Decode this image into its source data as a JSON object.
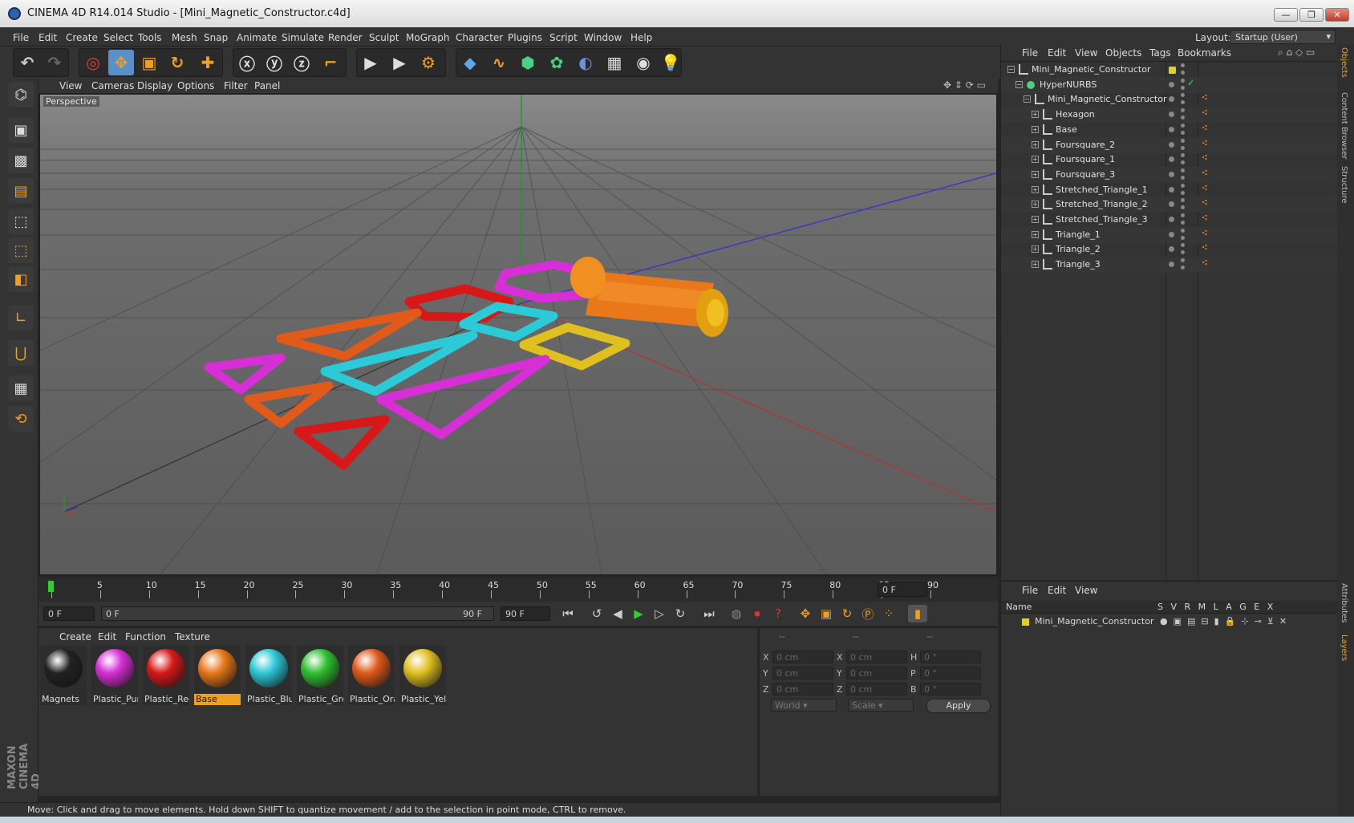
{
  "window": {
    "title": "CINEMA 4D R14.014 Studio - [Mini_Magnetic_Constructor.c4d]"
  },
  "menu": {
    "items": [
      "File",
      "Edit",
      "Create",
      "Select",
      "Tools",
      "Mesh",
      "Snap",
      "Animate",
      "Simulate",
      "Render",
      "Sculpt",
      "MoGraph",
      "Character",
      "Plugins",
      "Script",
      "Window",
      "Help"
    ],
    "layout_label": "Layout:",
    "layout_value": "Startup (User)"
  },
  "viewport": {
    "menu": [
      "View",
      "Cameras",
      "Display",
      "Options",
      "Filter",
      "Panel"
    ],
    "label": "Perspective"
  },
  "timeline": {
    "ticks": [
      "0",
      "5",
      "10",
      "15",
      "20",
      "25",
      "30",
      "35",
      "40",
      "45",
      "50",
      "55",
      "60",
      "65",
      "70",
      "75",
      "80",
      "85",
      "90"
    ],
    "current_frame": "0 F"
  },
  "transport": {
    "start": "0 F",
    "range_start": "0 F",
    "range_end": "90 F",
    "end": "90 F"
  },
  "materials": {
    "menu": [
      "Create",
      "Edit",
      "Function",
      "Texture"
    ],
    "items": [
      {
        "label": "Magnets",
        "color": "#222222"
      },
      {
        "label": "Plastic_Purp",
        "color": "#d62fd6"
      },
      {
        "label": "Plastic_Red",
        "color": "#d81818"
      },
      {
        "label": "Base",
        "color": "#e8781a"
      },
      {
        "label": "Plastic_Blue",
        "color": "#2cc9d6"
      },
      {
        "label": "Plastic_Gre",
        "color": "#30c030"
      },
      {
        "label": "Plastic_Ora",
        "color": "#e05a1a"
      },
      {
        "label": "Plastic_Yell",
        "color": "#e0c020"
      }
    ]
  },
  "coords": {
    "headers": [
      "--",
      "--",
      "--"
    ],
    "rows": [
      {
        "a": "X",
        "av": "0 cm",
        "b": "X",
        "bv": "0 cm",
        "c": "H",
        "cv": "0 °"
      },
      {
        "a": "Y",
        "av": "0 cm",
        "b": "Y",
        "bv": "0 cm",
        "c": "P",
        "cv": "0 °"
      },
      {
        "a": "Z",
        "av": "0 cm",
        "b": "Z",
        "bv": "0 cm",
        "c": "B",
        "cv": "0 °"
      }
    ],
    "world": "World",
    "scale": "Scale",
    "apply": "Apply"
  },
  "status": "Move: Click and drag to move elements. Hold down SHIFT to quantize movement / add to the selection in point mode, CTRL to remove.",
  "objects": {
    "menu": [
      "File",
      "Edit",
      "View",
      "Objects",
      "Tags",
      "Bookmarks"
    ],
    "tree": [
      {
        "name": "Mini_Magnetic_Constructor",
        "level": 0
      },
      {
        "name": "HyperNURBS",
        "level": 1
      },
      {
        "name": "Mini_Magnetic_Constructor",
        "level": 2
      },
      {
        "name": "Hexagon",
        "level": 3
      },
      {
        "name": "Base",
        "level": 3
      },
      {
        "name": "Foursquare_2",
        "level": 3
      },
      {
        "name": "Foursquare_1",
        "level": 3
      },
      {
        "name": "Foursquare_3",
        "level": 3
      },
      {
        "name": "Stretched_Triangle_1",
        "level": 3
      },
      {
        "name": "Stretched_Triangle_2",
        "level": 3
      },
      {
        "name": "Stretched_Triangle_3",
        "level": 3
      },
      {
        "name": "Triangle_1",
        "level": 3
      },
      {
        "name": "Triangle_2",
        "level": 3
      },
      {
        "name": "Triangle_3",
        "level": 3
      }
    ]
  },
  "layers": {
    "menu": [
      "File",
      "Edit",
      "View"
    ],
    "header_name": "Name",
    "header_cols": "S V R M L A G E X",
    "item": "Mini_Magnetic_Constructor"
  },
  "side_tabs": [
    "Objects",
    "Content Browser",
    "Structure",
    "Attributes",
    "Layers"
  ],
  "brand": "MAXON CINEMA 4D"
}
